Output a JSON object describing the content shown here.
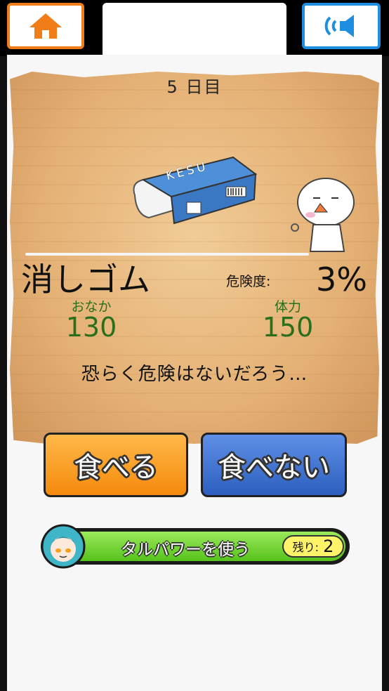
{
  "header": {
    "home_icon": "home-icon",
    "sound_icon": "speaker-icon"
  },
  "game": {
    "day": "5 日目",
    "item_name": "消しゴム",
    "danger_label": "危険度:",
    "danger_value": "3%",
    "stomach_label": "おなか",
    "stomach_value": "130",
    "stamina_label": "体力",
    "stamina_value": "150",
    "comment": "恐らく危険はないだろう…",
    "eraser_brand": "KESU"
  },
  "actions": {
    "eat_label": "食べる",
    "not_eat_label": "食べない"
  },
  "power": {
    "label": "タルパワーを使う",
    "remain_label": "残り:",
    "remain_count": "2"
  },
  "colors": {
    "home_accent": "#f07d18",
    "sound_accent": "#1e8fe0",
    "eat_button": "#f58a0c",
    "not_eat_button": "#2c5fbf",
    "stat_green": "#2a6f1c",
    "power_green": "#56c31c"
  }
}
